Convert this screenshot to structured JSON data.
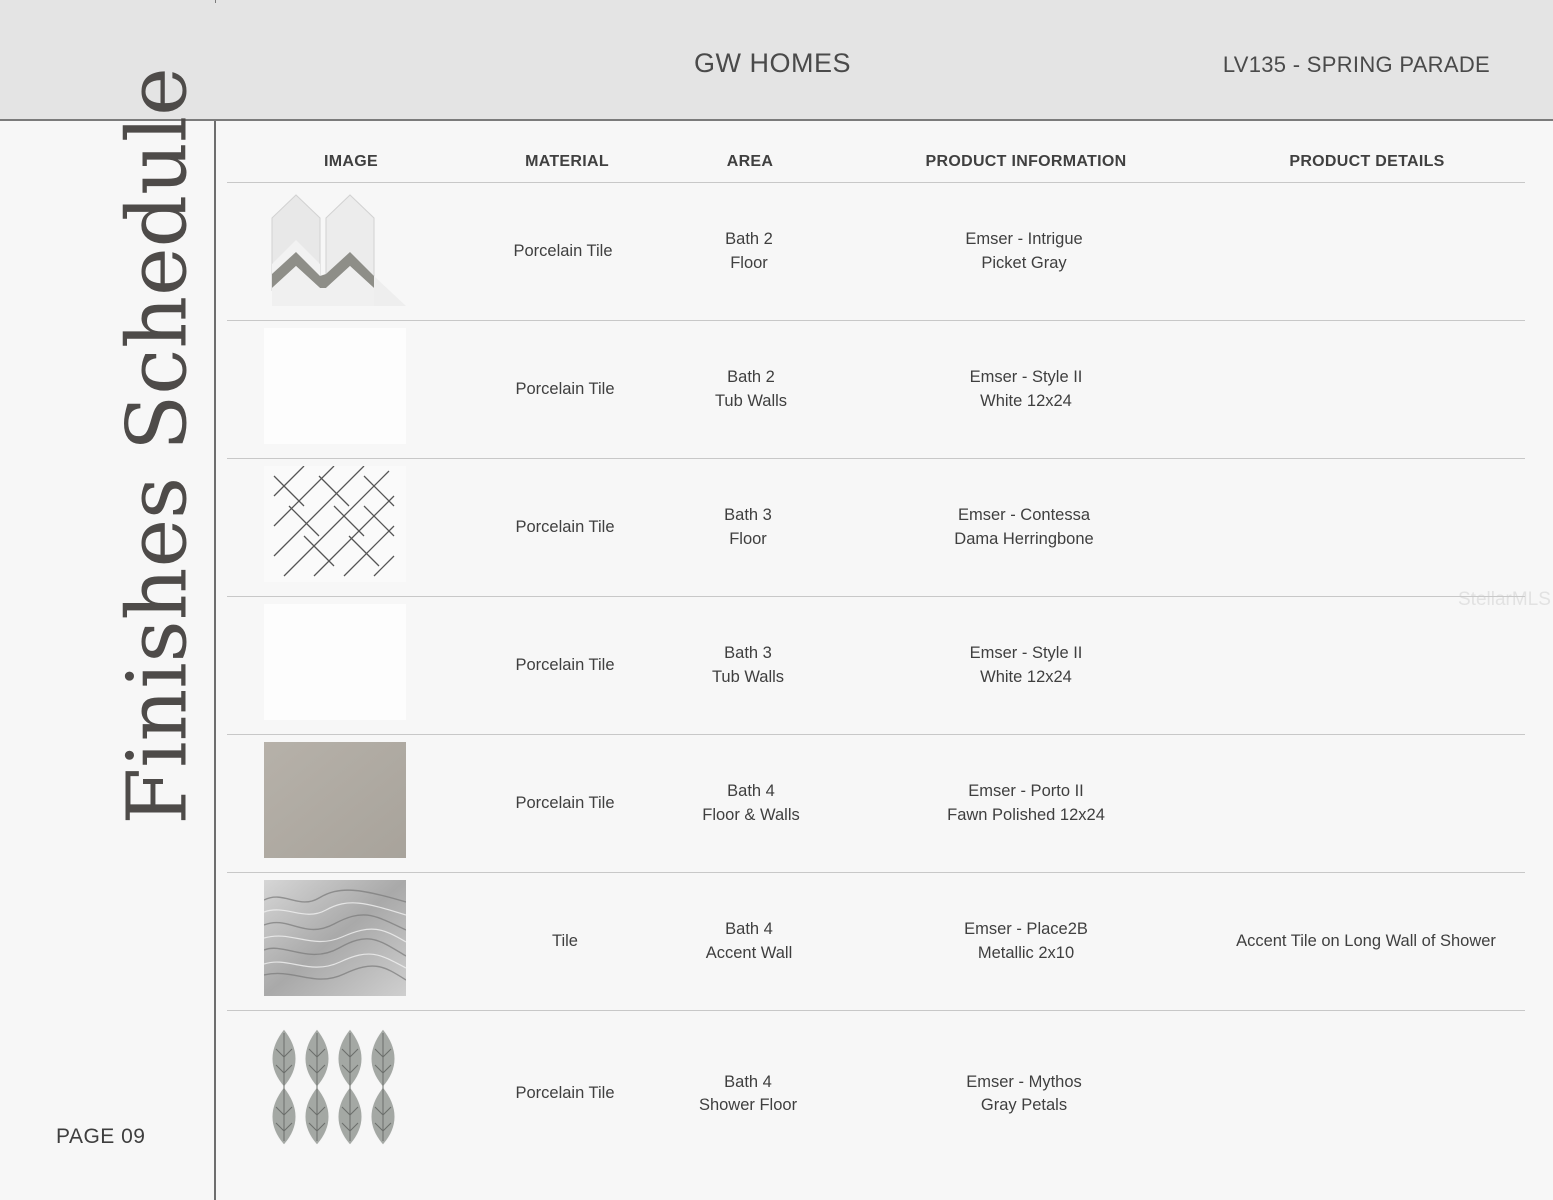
{
  "header": {
    "brand": "GW HOMES",
    "project": "LV135 - SPRING PARADE"
  },
  "sidebar": {
    "title": "Finishes Schedule",
    "page_number": "PAGE 09"
  },
  "watermark": "StellarMLS",
  "table": {
    "columns": [
      "IMAGE",
      "MATERIAL",
      "AREA",
      "PRODUCT INFORMATION",
      "PRODUCT DETAILS"
    ],
    "rows": [
      {
        "image": "picket-gray-tile-icon",
        "material": "Porcelain Tile",
        "area": [
          "Bath 2",
          "Floor"
        ],
        "product": [
          "Emser - Intrigue",
          "Picket Gray"
        ],
        "details": ""
      },
      {
        "image": "white-tile-icon",
        "material": "Porcelain Tile",
        "area": [
          "Bath 2",
          "Tub Walls"
        ],
        "product": [
          "Emser - Style II",
          "White 12x24"
        ],
        "details": ""
      },
      {
        "image": "herringbone-tile-icon",
        "material": "Porcelain Tile",
        "area": [
          "Bath 3",
          "Floor"
        ],
        "product": [
          "Emser - Contessa",
          "Dama Herringbone"
        ],
        "details": ""
      },
      {
        "image": "white-tile-icon",
        "material": "Porcelain Tile",
        "area": [
          "Bath 3",
          "Tub Walls"
        ],
        "product": [
          "Emser - Style II",
          "White 12x24"
        ],
        "details": ""
      },
      {
        "image": "fawn-tile-icon",
        "material": "Porcelain Tile",
        "area": [
          "Bath 4",
          "Floor & Walls"
        ],
        "product": [
          "Emser - Porto II",
          "Fawn Polished 12x24"
        ],
        "details": ""
      },
      {
        "image": "metallic-tile-icon",
        "material": "Tile",
        "area": [
          "Bath 4",
          "Accent Wall"
        ],
        "product": [
          "Emser - Place2B",
          "Metallic 2x10"
        ],
        "details": "Accent Tile on Long Wall of Shower"
      },
      {
        "image": "gray-petals-tile-icon",
        "material": "Porcelain Tile",
        "area": [
          "Bath 4",
          "Shower Floor"
        ],
        "product": [
          "Emser - Mythos",
          "Gray Petals"
        ],
        "details": ""
      }
    ]
  }
}
